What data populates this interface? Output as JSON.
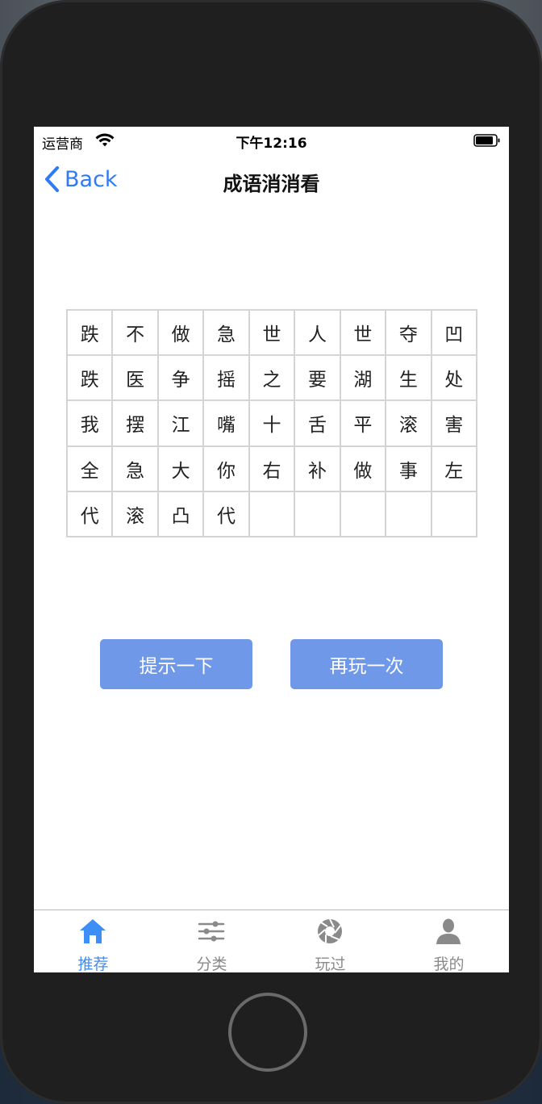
{
  "status_bar": {
    "carrier": "运营商",
    "time": "下午12:16"
  },
  "nav": {
    "back_label": "Back",
    "title": "成语消消看"
  },
  "grid": {
    "rows": [
      [
        "跌",
        "不",
        "做",
        "急",
        "世",
        "人",
        "世",
        "夺",
        "凹"
      ],
      [
        "跌",
        "医",
        "争",
        "摇",
        "之",
        "要",
        "湖",
        "生",
        "处"
      ],
      [
        "我",
        "摆",
        "江",
        "嘴",
        "十",
        "舌",
        "平",
        "滚",
        "害"
      ],
      [
        "全",
        "急",
        "大",
        "你",
        "右",
        "补",
        "做",
        "事",
        "左"
      ],
      [
        "代",
        "滚",
        "凸",
        "代",
        "",
        "",
        "",
        "",
        ""
      ]
    ]
  },
  "buttons": {
    "hint": "提示一下",
    "replay": "再玩一次"
  },
  "tabbar": {
    "tabs": [
      {
        "label": "推荐",
        "icon": "home-icon",
        "active": true
      },
      {
        "label": "分类",
        "icon": "sliders-icon",
        "active": false
      },
      {
        "label": "玩过",
        "icon": "aperture-icon",
        "active": false
      },
      {
        "label": "我的",
        "icon": "user-icon",
        "active": false
      }
    ]
  },
  "colors": {
    "accent": "#2f7bf6",
    "tab_active": "#3d8ef7",
    "tab_inactive": "#8a8a8a",
    "button_bg": "#6f98e8",
    "grid_border": "#d4d4d4"
  }
}
